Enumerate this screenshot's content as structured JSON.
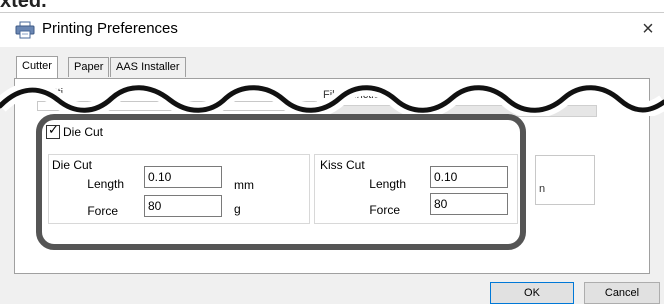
{
  "window": {
    "title": "Printing Preferences",
    "close_glyph": "×",
    "top_cut_text": "xted."
  },
  "tabs": [
    {
      "label": "Cutter",
      "active": true
    },
    {
      "label": "Paper",
      "active": false
    },
    {
      "label": "AAS Installer",
      "active": false
    }
  ],
  "background": {
    "settings_label": "Setti",
    "file_function_label": "File Function",
    "partial_unit": "n"
  },
  "die_cut_checkbox": {
    "label": "Die Cut",
    "checked": true,
    "check_glyph": "✓"
  },
  "die_cut_group": {
    "title": "Die Cut",
    "length_label": "Length",
    "length_value": "0.10",
    "length_unit": "mm",
    "force_label": "Force",
    "force_value": "80",
    "force_unit": "g"
  },
  "kiss_cut_group": {
    "title": "Kiss Cut",
    "length_label": "Length",
    "length_value": "0.10",
    "force_label": "Force",
    "force_value": "80"
  },
  "buttons": {
    "ok": "OK",
    "cancel": "Cancel"
  },
  "colors": {
    "frame": "#555555",
    "ok_border": "#0078d7"
  },
  "icons": {
    "title": "printer-icon",
    "close": "close-icon",
    "check": "checkmark-icon"
  }
}
